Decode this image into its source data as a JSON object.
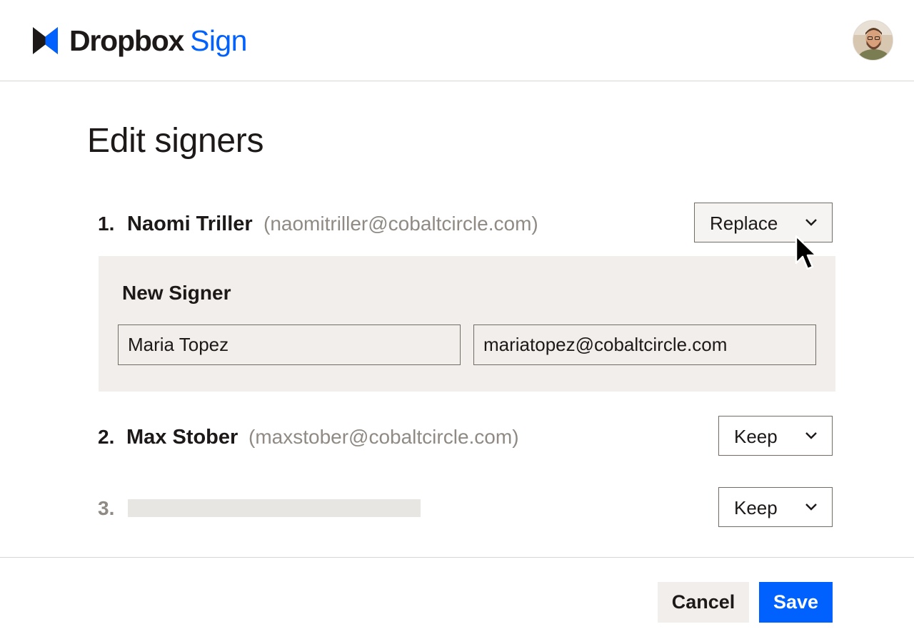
{
  "header": {
    "brand": "Dropbox",
    "product": "Sign",
    "brand_color": "#1e1919",
    "product_color": "#0061fe",
    "avatar_icon": "user-avatar"
  },
  "page": {
    "title": "Edit signers"
  },
  "signers": [
    {
      "number": "1.",
      "name": "Naomi Triller",
      "email": "(naomitriller@cobaltcircle.com)",
      "action": "Replace"
    },
    {
      "number": "2.",
      "name": "Max Stober",
      "email": "(maxstober@cobaltcircle.com)",
      "action": "Keep"
    },
    {
      "number": "3.",
      "name": "",
      "email": "",
      "action": "Keep"
    }
  ],
  "new_signer": {
    "title": "New Signer",
    "name_value": "Maria Topez",
    "email_value": "mariatopez@cobaltcircle.com"
  },
  "footer": {
    "cancel_label": "Cancel",
    "save_label": "Save",
    "save_color": "#0061fe"
  },
  "icons": {
    "chevron": "chevron-down-icon",
    "cursor": "mouse-pointer-icon"
  }
}
